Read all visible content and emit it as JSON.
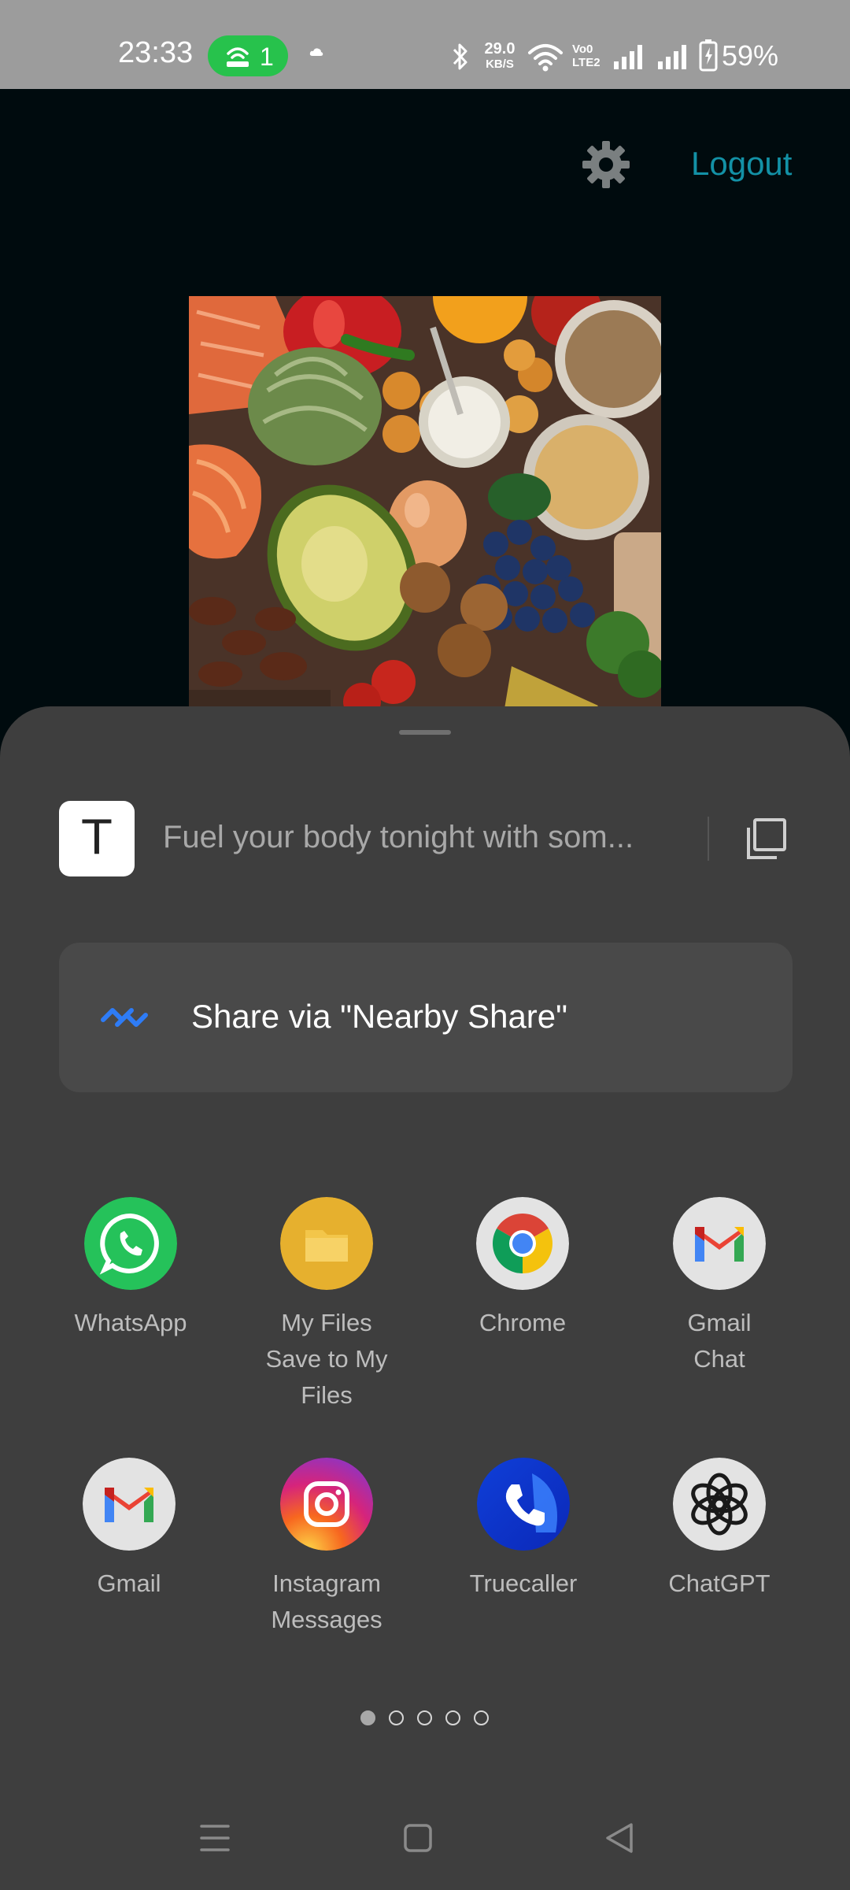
{
  "status_bar": {
    "time": "23:33",
    "hotspot_count": "1",
    "net_speed": "29.0",
    "net_speed_unit": "KB/S",
    "volte": [
      "Vo0",
      "LTE2"
    ],
    "battery": "59%"
  },
  "app": {
    "logout_label": "Logout",
    "settings_icon": "gear-icon",
    "image_alt": "Food flat lay"
  },
  "share_sheet": {
    "preview_icon_letter": "T",
    "preview_text": "Fuel your body tonight with som...",
    "nearby_label": "Share via \"Nearby Share\"",
    "apps": [
      {
        "line1": "WhatsApp",
        "line2": "",
        "line3": ""
      },
      {
        "line1": "My Files",
        "line2": "Save to My",
        "line3": "Files"
      },
      {
        "line1": "Chrome",
        "line2": "",
        "line3": ""
      },
      {
        "line1": "Gmail",
        "line2": "Chat",
        "line3": ""
      },
      {
        "line1": "Gmail",
        "line2": "",
        "line3": ""
      },
      {
        "line1": "Instagram",
        "line2": "Messages",
        "line3": ""
      },
      {
        "line1": "Truecaller",
        "line2": "",
        "line3": ""
      },
      {
        "line1": "ChatGPT",
        "line2": "",
        "line3": ""
      }
    ],
    "page_count": 5,
    "current_page": 1
  },
  "colors": {
    "accent": "#1391a6",
    "sheet_bg": "#3e3e3e",
    "whatsapp": "#25d366",
    "nearby": "#2e7cf6"
  }
}
